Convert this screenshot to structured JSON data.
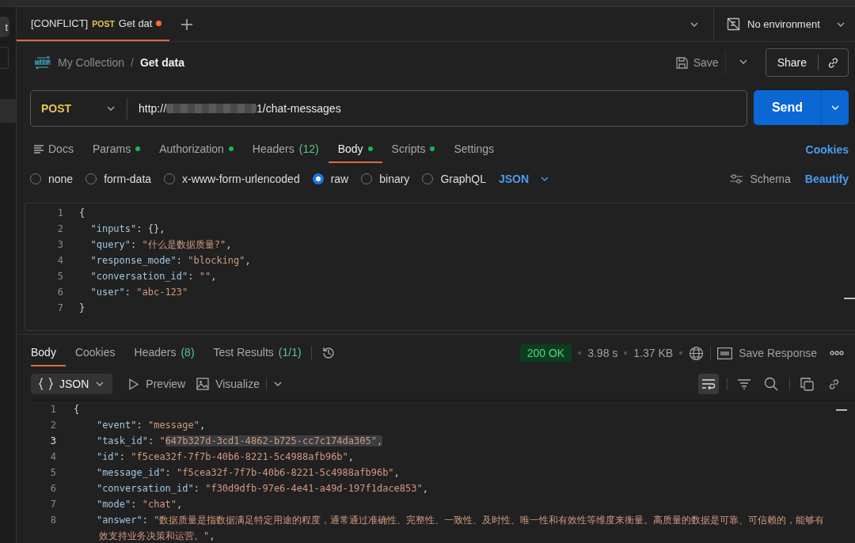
{
  "sidebar": {
    "button": "t"
  },
  "tabs": [
    {
      "conflict": "[CONFLICT]",
      "method": "POST",
      "title": "Get dat",
      "unsaved": true,
      "selected": true
    }
  ],
  "environment": {
    "label": "No environment"
  },
  "breadcrumb": {
    "collection": "My Collection",
    "separator": "/",
    "request": "Get data"
  },
  "actions": {
    "save": "Save",
    "share": "Share"
  },
  "request": {
    "method": "POST",
    "url": {
      "prefix": "http://",
      "redacted": true,
      "suffix": "1/chat-messages"
    },
    "send": "Send"
  },
  "request_tabs": [
    {
      "kind": "docs",
      "label": "Docs",
      "dot": false,
      "selected": false
    },
    {
      "kind": "tab",
      "label": "Params",
      "dot": true,
      "selected": false
    },
    {
      "kind": "tab",
      "label": "Authorization",
      "dot": true,
      "selected": false
    },
    {
      "kind": "tab",
      "label": "Headers",
      "count": "(12)",
      "dot": false,
      "selected": false
    },
    {
      "kind": "tab",
      "label": "Body",
      "dot": true,
      "selected": true
    },
    {
      "kind": "tab",
      "label": "Scripts",
      "dot": true,
      "selected": false
    },
    {
      "kind": "tab",
      "label": "Settings",
      "dot": false,
      "selected": false
    }
  ],
  "cookies": "Cookies",
  "body_types": [
    {
      "label": "none",
      "selected": false
    },
    {
      "label": "form-data",
      "selected": false
    },
    {
      "label": "x-www-form-urlencoded",
      "selected": false
    },
    {
      "label": "raw",
      "selected": true
    },
    {
      "label": "binary",
      "selected": false
    },
    {
      "label": "GraphQL",
      "selected": false
    }
  ],
  "format": "JSON",
  "schema": "Schema",
  "beautify": "Beautify",
  "request_body": [
    {
      "number": "1",
      "tokens": [
        {
          "kind": "punct",
          "text": "{"
        }
      ]
    },
    {
      "number": "2",
      "tokens": [
        {
          "kind": "key",
          "text": "  \"inputs\""
        },
        {
          "kind": "punct",
          "text": ": {},"
        }
      ]
    },
    {
      "number": "3",
      "tokens": [
        {
          "kind": "key",
          "text": "  \"query\""
        },
        {
          "kind": "punct",
          "text": ": "
        },
        {
          "kind": "string",
          "text": "\"什么是数据质量?\""
        },
        {
          "kind": "punct",
          "text": ","
        }
      ]
    },
    {
      "number": "4",
      "tokens": [
        {
          "kind": "key",
          "text": "  \"response_mode\""
        },
        {
          "kind": "punct",
          "text": ": "
        },
        {
          "kind": "string",
          "text": "\"blocking\""
        },
        {
          "kind": "punct",
          "text": ","
        }
      ]
    },
    {
      "number": "5",
      "tokens": [
        {
          "kind": "key",
          "text": "  \"conversation_id\""
        },
        {
          "kind": "punct",
          "text": ": "
        },
        {
          "kind": "string",
          "text": "\"\""
        },
        {
          "kind": "punct",
          "text": ","
        }
      ]
    },
    {
      "number": "6",
      "tokens": [
        {
          "kind": "key",
          "text": "  \"user\""
        },
        {
          "kind": "punct",
          "text": ": "
        },
        {
          "kind": "string",
          "text": "\"abc-123\""
        }
      ]
    },
    {
      "number": "7",
      "tokens": [
        {
          "kind": "punct",
          "text": "}"
        }
      ]
    }
  ],
  "response": {
    "tabs": [
      {
        "label": "Body",
        "selected": true
      },
      {
        "label": "Cookies",
        "selected": false
      },
      {
        "label": "Headers",
        "count": "(8)",
        "selected": false
      },
      {
        "label": "Test Results",
        "count": "(1/1)",
        "selected": false
      }
    ],
    "status": "200 OK",
    "time": "3.98 s",
    "size": "1.37 KB",
    "save_response": "Save Response",
    "view": "JSON",
    "preview": "Preview",
    "visualize": "Visualize",
    "wrap_on": true,
    "lines": [
      {
        "number": "1",
        "current": false,
        "tokens": [
          {
            "kind": "punct",
            "text": "{"
          }
        ]
      },
      {
        "number": "2",
        "current": false,
        "tokens": [
          {
            "kind": "key",
            "text": "    \"event\""
          },
          {
            "kind": "punct",
            "text": ": "
          },
          {
            "kind": "string",
            "text": "\"message\""
          },
          {
            "kind": "punct",
            "text": ","
          }
        ]
      },
      {
        "number": "3",
        "current": true,
        "tokens": [
          {
            "kind": "key",
            "text": "    \"task_id\""
          },
          {
            "kind": "punct",
            "text": ": "
          },
          {
            "kind": "string",
            "text": "\""
          },
          {
            "kind": "selection",
            "text": "647b327d-3cd1-4862-b725-cc7c174da305\","
          }
        ]
      },
      {
        "number": "4",
        "current": false,
        "tokens": [
          {
            "kind": "key",
            "text": "    \"id\""
          },
          {
            "kind": "punct",
            "text": ": "
          },
          {
            "kind": "string",
            "text": "\"f5cea32f-7f7b-40b6-8221-5c4988afb96b\""
          },
          {
            "kind": "punct",
            "text": ","
          }
        ]
      },
      {
        "number": "5",
        "current": false,
        "tokens": [
          {
            "kind": "key",
            "text": "    \"message_id\""
          },
          {
            "kind": "punct",
            "text": ": "
          },
          {
            "kind": "string",
            "text": "\"f5cea32f-7f7b-40b6-8221-5c4988afb96b\""
          },
          {
            "kind": "punct",
            "text": ","
          }
        ]
      },
      {
        "number": "6",
        "current": false,
        "tokens": [
          {
            "kind": "key",
            "text": "    \"conversation_id\""
          },
          {
            "kind": "punct",
            "text": ": "
          },
          {
            "kind": "string",
            "text": "\"f30d9dfb-97e6-4e41-a49d-197f1dace853\""
          },
          {
            "kind": "punct",
            "text": ","
          }
        ]
      },
      {
        "number": "7",
        "current": false,
        "tokens": [
          {
            "kind": "key",
            "text": "    \"mode\""
          },
          {
            "kind": "punct",
            "text": ": "
          },
          {
            "kind": "string",
            "text": "\"chat\""
          },
          {
            "kind": "punct",
            "text": ","
          }
        ]
      },
      {
        "number": "8",
        "current": false,
        "tokens": [
          {
            "kind": "key",
            "text": "    \"answer\""
          },
          {
            "kind": "punct",
            "text": ": "
          },
          {
            "kind": "string",
            "text": "\"数据质量是指数据满足特定用途的程度，通常通过准确性、完整性、一致性、及时性、唯一性和有效性等维度来衡量。高质量的数据是可靠、可信赖的，能够有效支持业务决策和运营。\""
          },
          {
            "kind": "punct",
            "text": ","
          }
        ]
      }
    ]
  }
}
